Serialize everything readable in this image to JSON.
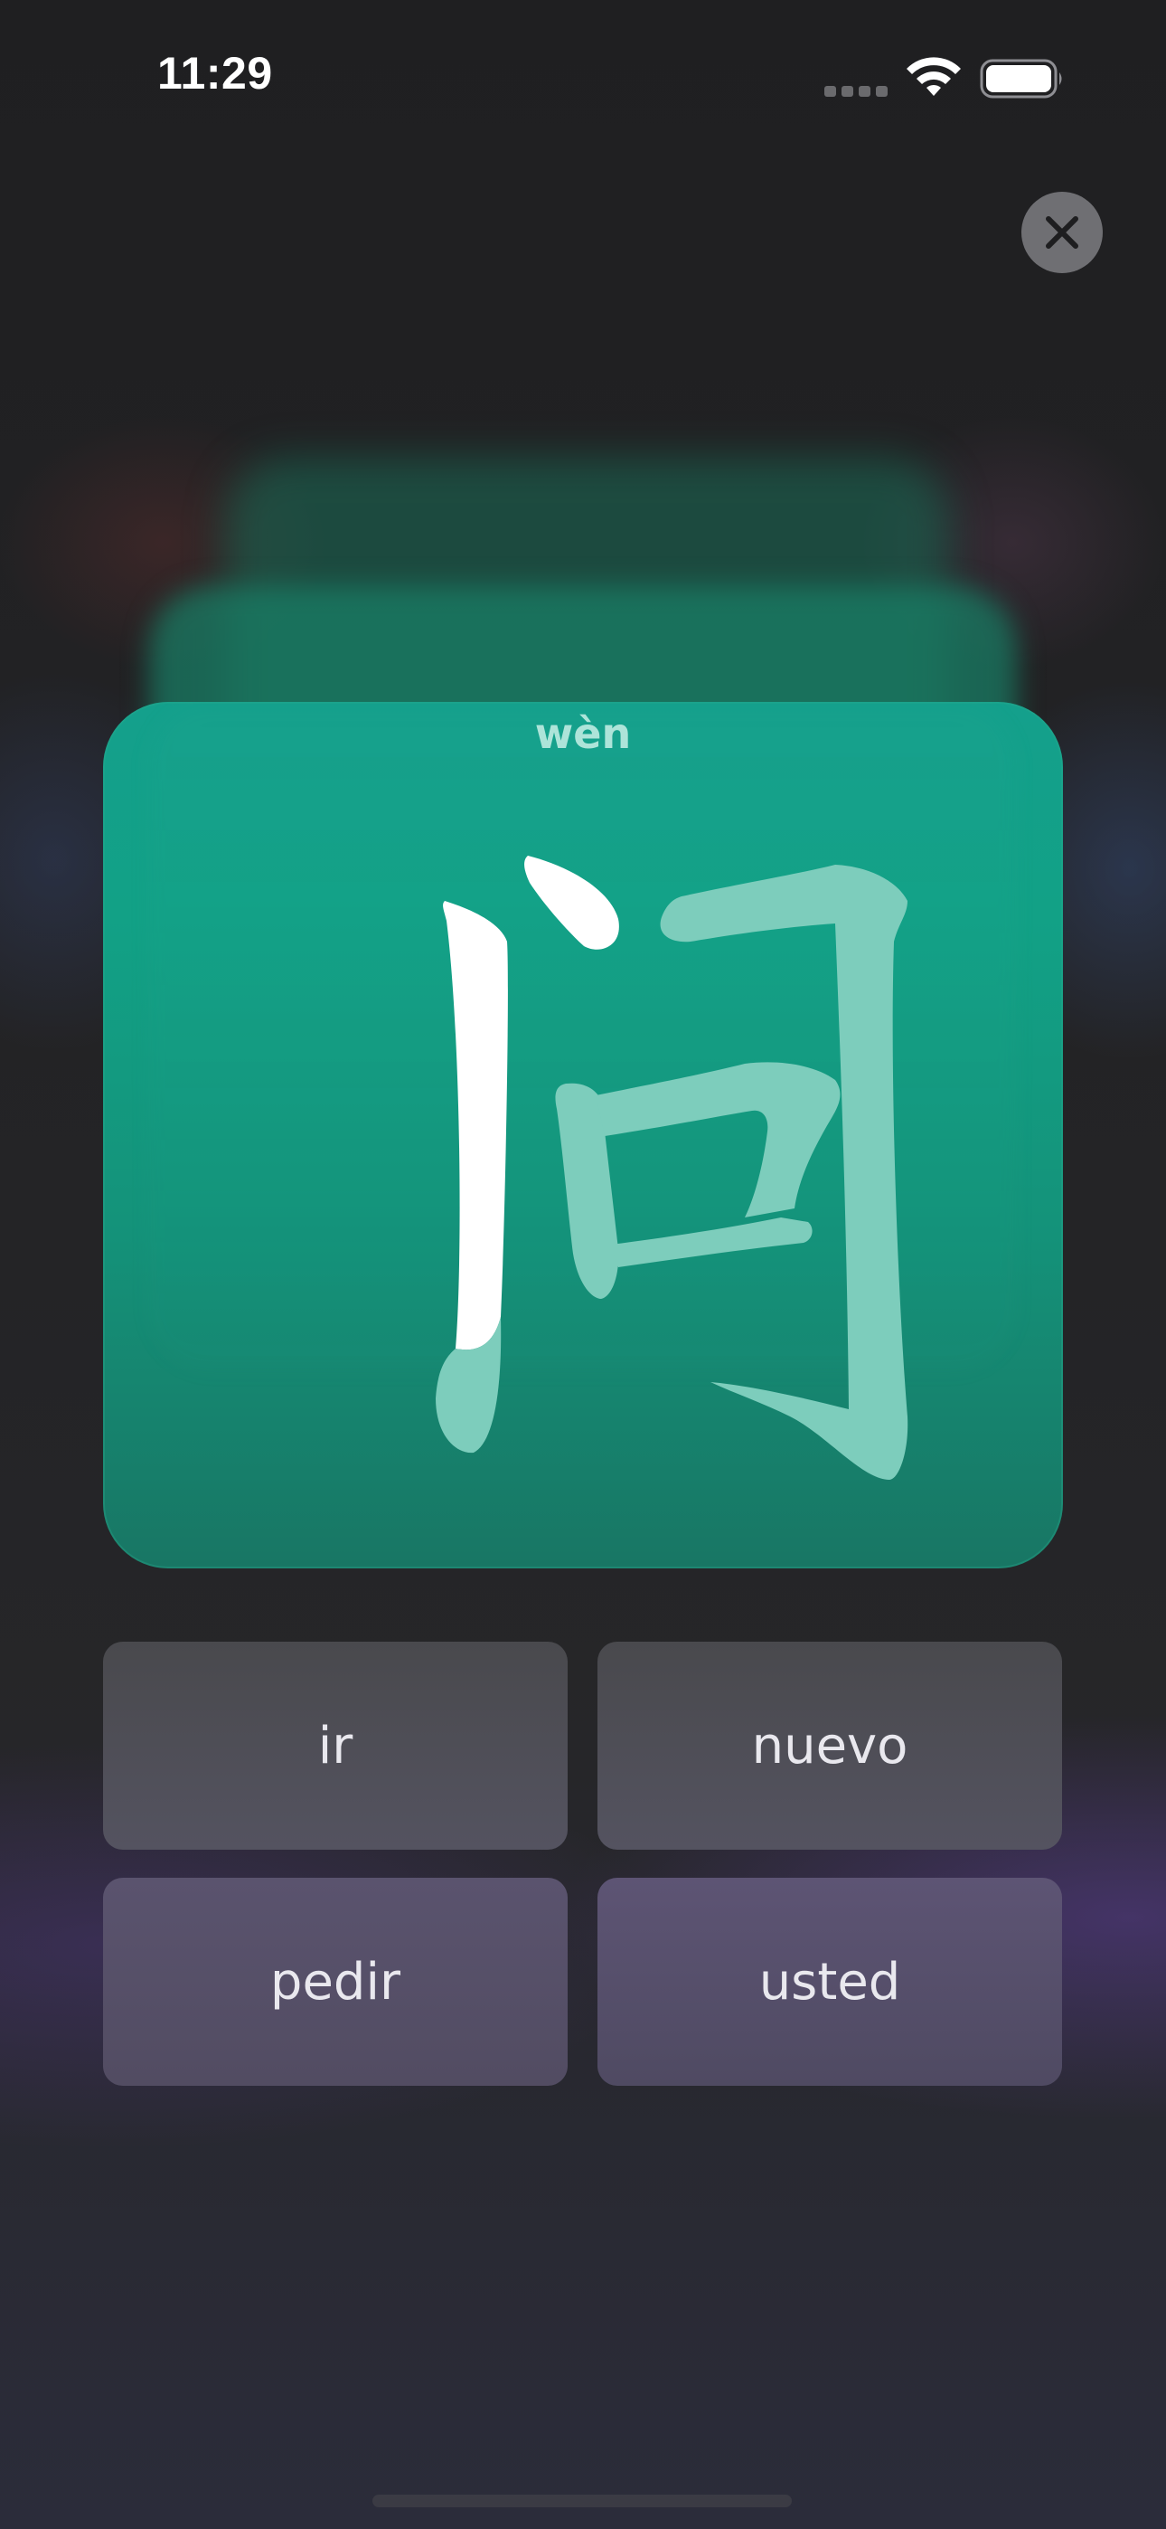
{
  "status_bar": {
    "time": "11:29",
    "wifi_icon": "wifi-icon",
    "battery_icon": "battery-icon"
  },
  "close_icon": "close-icon",
  "card": {
    "pinyin": "wèn",
    "character": "问",
    "colors": {
      "card_top": "#14a08c",
      "card_bottom": "#187664",
      "highlighted_stroke": "#ffffff",
      "remaining_strokes": "#7dcdbc"
    }
  },
  "options": [
    {
      "label": "ir"
    },
    {
      "label": "nuevo"
    },
    {
      "label": "pedir"
    },
    {
      "label": "usted"
    }
  ]
}
